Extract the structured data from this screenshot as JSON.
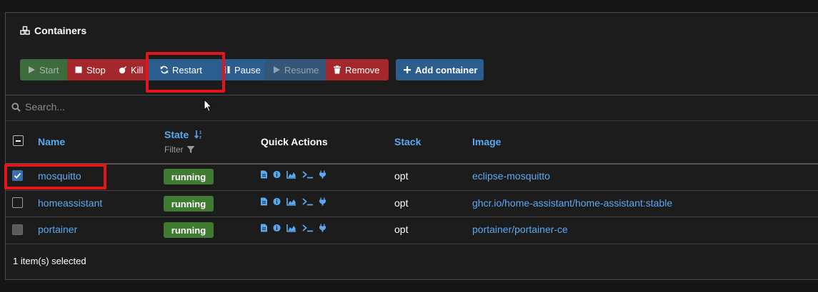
{
  "panel": {
    "title": "Containers"
  },
  "toolbar": {
    "start": "Start",
    "stop": "Stop",
    "kill": "Kill",
    "restart": "Restart",
    "pause": "Pause",
    "resume": "Resume",
    "remove": "Remove",
    "add_container": "Add container"
  },
  "search": {
    "placeholder": "Search..."
  },
  "table": {
    "headers": {
      "name": "Name",
      "state": "State",
      "state_filter": "Filter",
      "quick_actions": "Quick Actions",
      "stack": "Stack",
      "image": "Image"
    },
    "rows": [
      {
        "name": "mosquitto",
        "state": "running",
        "stack": "opt",
        "image": "eclipse-mosquitto",
        "selected": true
      },
      {
        "name": "homeassistant",
        "state": "running",
        "stack": "opt",
        "image": "ghcr.io/home-assistant/home-assistant:stable",
        "selected": false
      },
      {
        "name": "portainer",
        "state": "running",
        "stack": "opt",
        "image": "portainer/portainer-ce",
        "selected": false
      }
    ],
    "quick_action_icons": [
      "logs-icon",
      "inspect-icon",
      "stats-icon",
      "console-icon",
      "attach-icon"
    ]
  },
  "footer": {
    "selection_text": "1 item(s) selected"
  },
  "colors": {
    "accent": "#5aa9f0",
    "running": "#3f7c31",
    "danger": "#a4282b",
    "primary": "#2c5d8f",
    "highlight": "#e3141b"
  }
}
